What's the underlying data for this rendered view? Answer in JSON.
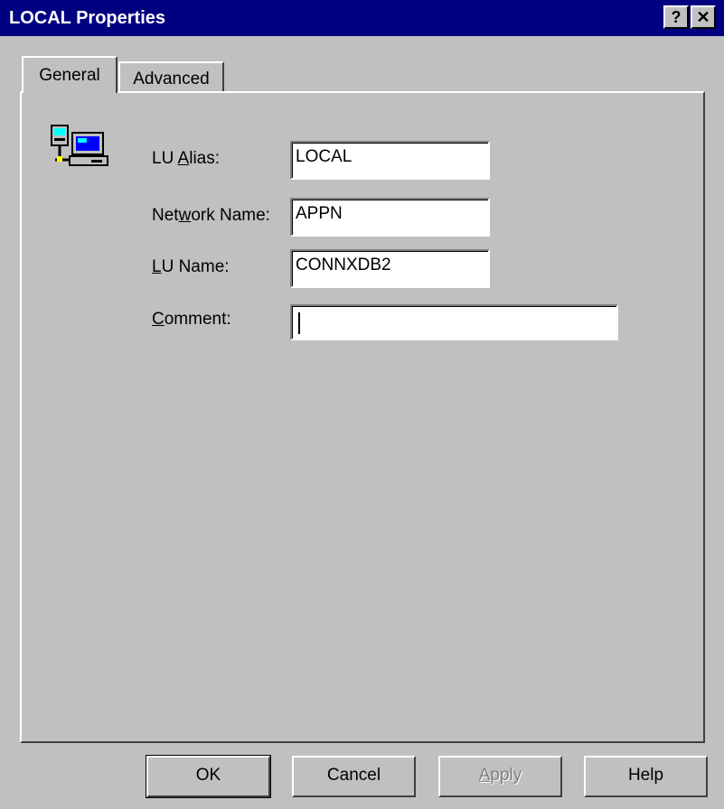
{
  "window": {
    "title": "LOCAL Properties",
    "help_button": "?",
    "close_button": "✕"
  },
  "tabs": [
    {
      "pre": "",
      "ul": "",
      "post": "General",
      "active": true
    },
    {
      "pre": "",
      "ul": "",
      "post": "Advanced",
      "active": false
    }
  ],
  "form": {
    "lu_alias": {
      "pre": "LU ",
      "ul": "A",
      "post": "lias:",
      "value": "LOCAL"
    },
    "network_name": {
      "pre": "Net",
      "ul": "w",
      "post": "ork Name:",
      "value": "APPN"
    },
    "lu_name": {
      "pre": "",
      "ul": "L",
      "post": "U Name:",
      "value": "CONNXDB2"
    },
    "comment": {
      "pre": "",
      "ul": "C",
      "post": "omment:",
      "value": ""
    }
  },
  "icon": "network-computer-icon",
  "buttons": {
    "ok": "OK",
    "cancel": "Cancel",
    "apply": {
      "pre": "",
      "ul": "A",
      "post": "pply"
    },
    "help": "Help"
  }
}
